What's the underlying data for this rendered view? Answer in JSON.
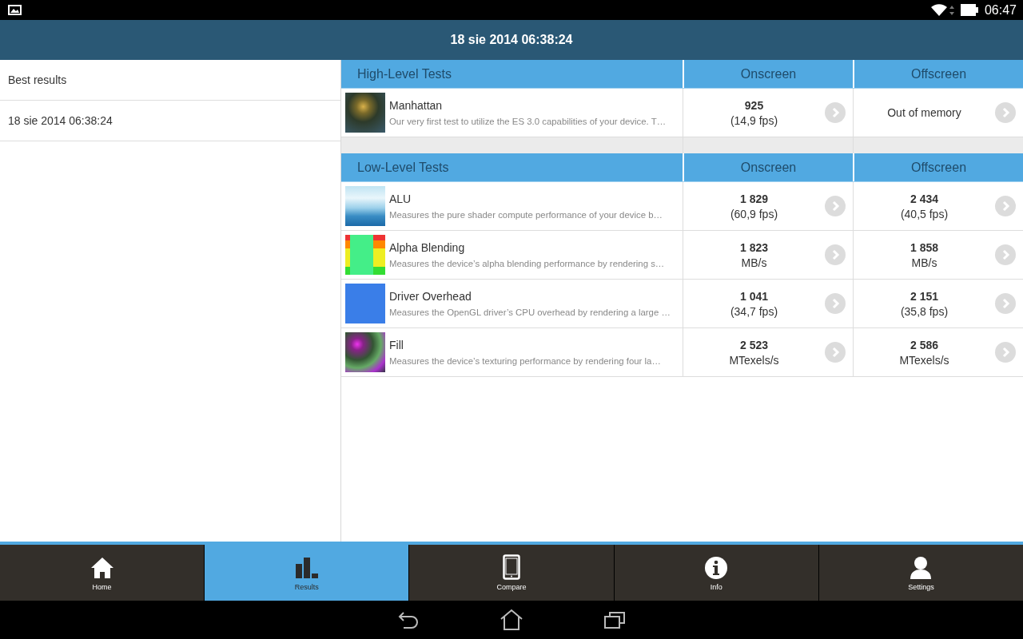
{
  "status_bar": {
    "time": "06:47"
  },
  "header": {
    "title": "18 sie 2014 06:38:24"
  },
  "sidebar": {
    "items": [
      {
        "label": "Best results",
        "selected": false
      },
      {
        "label": "18 sie 2014 06:38:24",
        "selected": false
      }
    ]
  },
  "sections": [
    {
      "title": "High-Level Tests",
      "columns": [
        "Onscreen",
        "Offscreen"
      ],
      "rows": [
        {
          "name": "Manhattan",
          "description": "Our very first test to utilize the ES 3.0 capabilities of your device. T…",
          "results": [
            {
              "kind": "score",
              "value": "925",
              "unit": "(14,9 fps)"
            },
            {
              "kind": "message",
              "text": "Out of memory"
            }
          ]
        }
      ]
    },
    {
      "title": "Low-Level Tests",
      "columns": [
        "Onscreen",
        "Offscreen"
      ],
      "rows": [
        {
          "name": "ALU",
          "description": "Measures the pure shader compute performance of your device b…",
          "results": [
            {
              "kind": "score",
              "value": "1 829",
              "unit": "(60,9 fps)"
            },
            {
              "kind": "score",
              "value": "2 434",
              "unit": "(40,5 fps)"
            }
          ]
        },
        {
          "name": "Alpha Blending",
          "description": "Measures the device’s alpha blending performance by rendering s…",
          "results": [
            {
              "kind": "score",
              "value": "1 823",
              "unit": "MB/s"
            },
            {
              "kind": "score",
              "value": "1 858",
              "unit": "MB/s"
            }
          ]
        },
        {
          "name": "Driver Overhead",
          "description": "Measures the OpenGL driver’s CPU overhead by rendering a large …",
          "results": [
            {
              "kind": "score",
              "value": "1 041",
              "unit": "(34,7 fps)"
            },
            {
              "kind": "score",
              "value": "2 151",
              "unit": "(35,8 fps)"
            }
          ]
        },
        {
          "name": "Fill",
          "description": "Measures the device’s texturing performance by rendering four la…",
          "results": [
            {
              "kind": "score",
              "value": "2 523",
              "unit": "MTexels/s"
            },
            {
              "kind": "score",
              "value": "2 586",
              "unit": "MTexels/s"
            }
          ]
        }
      ]
    }
  ],
  "tabs": [
    {
      "kind": "home",
      "label": "Home",
      "selected": false
    },
    {
      "kind": "results",
      "label": "Results",
      "selected": true
    },
    {
      "kind": "compare",
      "label": "Compare",
      "selected": false
    },
    {
      "kind": "info",
      "label": "Info",
      "selected": false
    },
    {
      "kind": "settings",
      "label": "Settings",
      "selected": false
    }
  ]
}
